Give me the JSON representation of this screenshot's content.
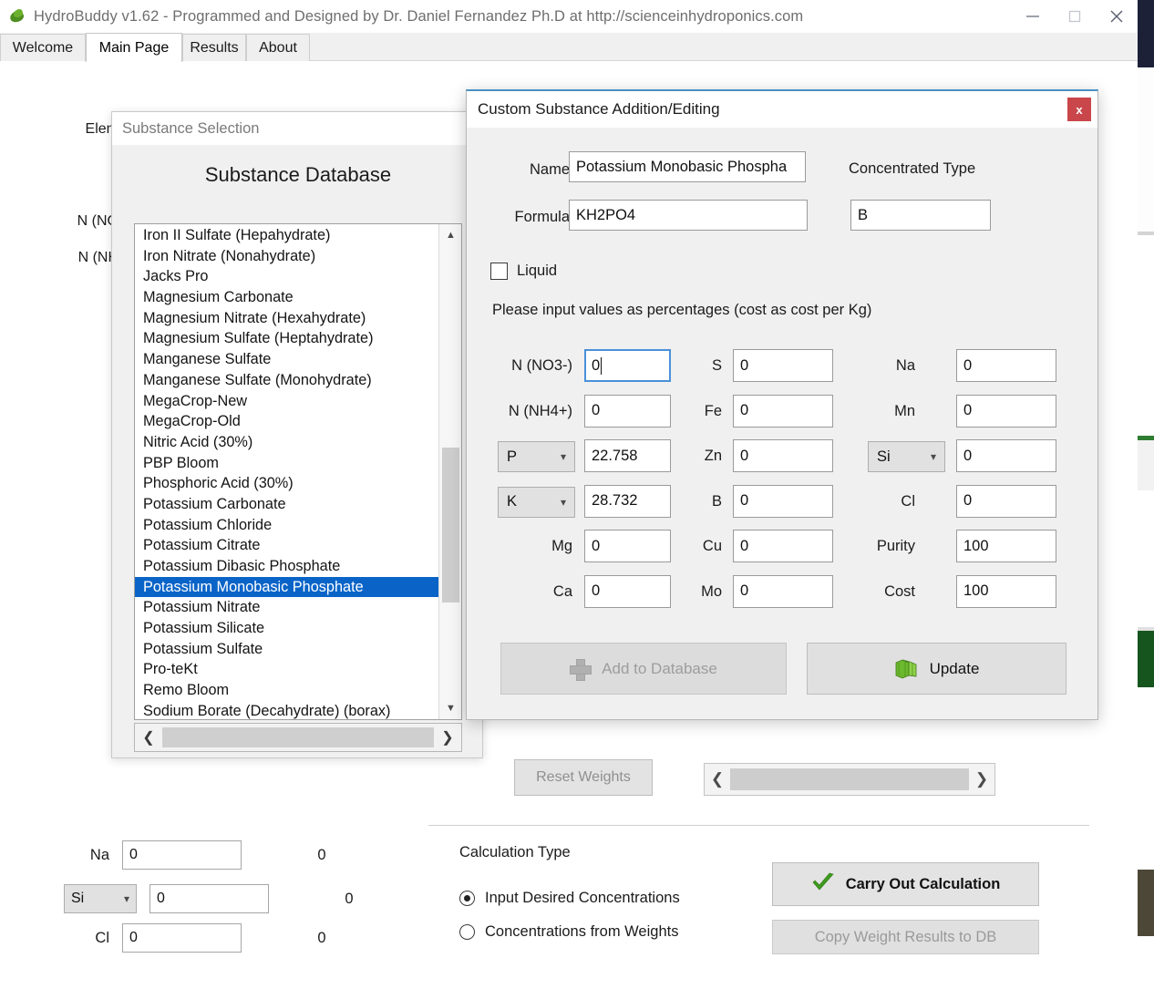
{
  "window": {
    "title": "HydroBuddy v1.62 - Programmed and Designed by Dr. Daniel Fernandez Ph.D at http://scienceinhydroponics.com",
    "app_icon": "leaf-icon",
    "minimize": "minimize-icon",
    "maximize": "maximize-icon",
    "close": "close-icon"
  },
  "tabs": [
    {
      "label": "Welcome",
      "active": false
    },
    {
      "label": "Main Page",
      "active": true
    },
    {
      "label": "Results",
      "active": false
    },
    {
      "label": "About",
      "active": false
    }
  ],
  "main_page": {
    "column_header": "Elem",
    "occluded_labels": [
      "N (NO",
      "N (NH"
    ],
    "rows": [
      {
        "label": "Na",
        "value": "0",
        "result": "0",
        "combo": null
      },
      {
        "label": "",
        "value": "0",
        "result": "0",
        "combo": "Si"
      },
      {
        "label": "Cl",
        "value": "0",
        "result": "0",
        "combo": null
      }
    ],
    "reset_weights_label": "Reset Weights",
    "calculation": {
      "title": "Calculation Type",
      "options": [
        {
          "label": "Input Desired Concentrations",
          "selected": true
        },
        {
          "label": "Concentrations from  Weights",
          "selected": false
        }
      ],
      "carry_out_label": "Carry Out Calculation",
      "copy_results_label": "Copy Weight Results to DB",
      "copy_results_disabled": true
    }
  },
  "substance_selection": {
    "window_title": "Substance Selection",
    "heading": "Substance Database",
    "items": [
      "Iron II Sulfate (Hepahydrate)",
      "Iron Nitrate (Nonahydrate)",
      "Jacks Pro",
      "Magnesium Carbonate",
      "Magnesium Nitrate (Hexahydrate)",
      "Magnesium Sulfate (Heptahydrate)",
      "Manganese Sulfate",
      "Manganese Sulfate (Monohydrate)",
      "MegaCrop-New",
      "MegaCrop-Old",
      "Nitric Acid (30%)",
      "PBP Bloom",
      "Phosphoric Acid (30%)",
      "Potassium Carbonate",
      "Potassium Chloride",
      "Potassium Citrate",
      "Potassium Dibasic Phosphate",
      "Potassium Monobasic Phosphate",
      "Potassium Nitrate",
      "Potassium Silicate",
      "Potassium Sulfate",
      "Pro-teKt",
      "Remo Bloom",
      "Sodium Borate (Decahydrate) (borax)"
    ],
    "selected_index": 17,
    "scroll_up_icon": "chevron-up-icon",
    "scroll_down_icon": "chevron-down-icon",
    "hscroll_left_icon": "chevron-left-icon",
    "hscroll_right_icon": "chevron-right-icon"
  },
  "dialog": {
    "title": "Custom Substance Addition/Editing",
    "close_label": "x",
    "name_label": "Name",
    "name_value": "Potassium Monobasic Phospha",
    "formula_label": "Formula",
    "formula_value": "KH2PO4",
    "concentrated_type_label": "Concentrated Type",
    "concentrated_type_value": "B",
    "liquid_label": "Liquid",
    "liquid_checked": false,
    "instructions": "Please input values as percentages (cost as cost per Kg)",
    "col1": [
      {
        "label": "N (NO3-)",
        "value": "0",
        "combo": false,
        "focused": true
      },
      {
        "label": "N (NH4+)",
        "value": "0",
        "combo": false,
        "focused": false
      },
      {
        "label": "P",
        "value": "22.758",
        "combo": true,
        "focused": false
      },
      {
        "label": "K",
        "value": "28.732",
        "combo": true,
        "focused": false
      },
      {
        "label": "Mg",
        "value": "0",
        "combo": false,
        "focused": false
      },
      {
        "label": "Ca",
        "value": "0",
        "combo": false,
        "focused": false
      }
    ],
    "col2": [
      {
        "label": "S",
        "value": "0",
        "combo": false
      },
      {
        "label": "Fe",
        "value": "0",
        "combo": false
      },
      {
        "label": "Zn",
        "value": "0",
        "combo": false
      },
      {
        "label": "B",
        "value": "0",
        "combo": false
      },
      {
        "label": "Cu",
        "value": "0",
        "combo": false
      },
      {
        "label": "Mo",
        "value": "0",
        "combo": false
      }
    ],
    "col3": [
      {
        "label": "Na",
        "value": "0",
        "combo": false
      },
      {
        "label": "Mn",
        "value": "0",
        "combo": false
      },
      {
        "label": "Si",
        "value": "0",
        "combo": true
      },
      {
        "label": "Cl",
        "value": "0",
        "combo": false
      },
      {
        "label": "Purity",
        "value": "100",
        "combo": false
      },
      {
        "label": "Cost",
        "value": "100",
        "combo": false
      }
    ],
    "add_button_label": "Add to Database",
    "add_button_disabled": true,
    "update_button_label": "Update"
  },
  "colors": {
    "selection_blue": "#0a64c8",
    "focus_blue": "#4a90d9",
    "close_red": "#c9474b",
    "dialog_accent": "#4a90c4",
    "window_bg": "#f0f0f0"
  }
}
